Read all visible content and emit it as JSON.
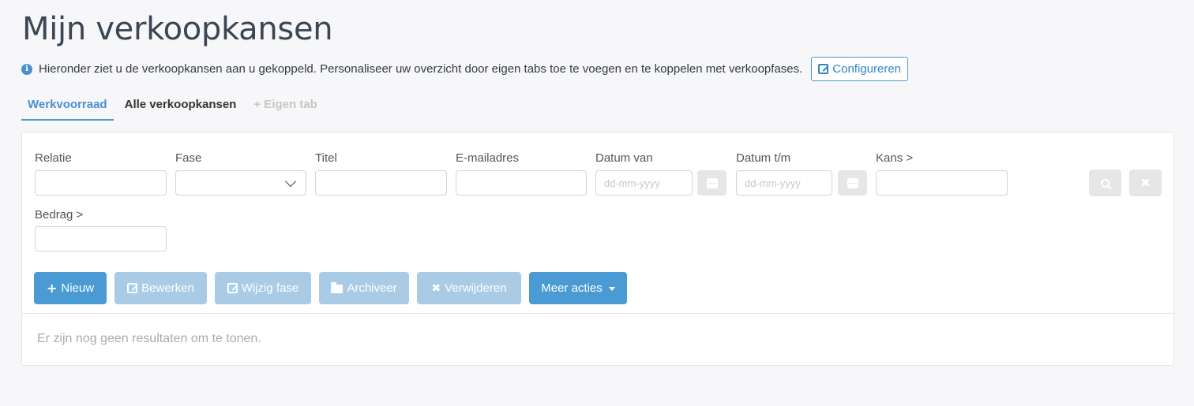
{
  "page": {
    "title": "Mijn verkoopkansen",
    "info_text": "Hieronder ziet u de verkoopkansen aan u gekoppeld. Personaliseer uw overzicht door eigen tabs toe te voegen en te koppelen met verkoopfases.",
    "configure_label": "Configureren"
  },
  "tabs": [
    {
      "label": "Werkvoorraad",
      "active": true
    },
    {
      "label": "Alle verkoopkansen",
      "active": false
    },
    {
      "label": "+ Eigen tab",
      "active": false
    }
  ],
  "filters": {
    "relatie": {
      "label": "Relatie",
      "value": ""
    },
    "fase": {
      "label": "Fase",
      "value": ""
    },
    "titel": {
      "label": "Titel",
      "value": ""
    },
    "email": {
      "label": "E-mailadres",
      "value": ""
    },
    "datum_van": {
      "label": "Datum van",
      "placeholder": "dd-mm-yyyy"
    },
    "datum_tm": {
      "label": "Datum t/m",
      "placeholder": "dd-mm-yyyy"
    },
    "kans": {
      "label": "Kans >",
      "value": ""
    },
    "bedrag": {
      "label": "Bedrag >",
      "value": ""
    }
  },
  "actions": {
    "nieuw": "Nieuw",
    "bewerken": "Bewerken",
    "wijzig_fase": "Wijzig fase",
    "archiveer": "Archiveer",
    "verwijderen": "Verwijderen",
    "meer_acties": "Meer acties"
  },
  "results": {
    "empty_message": "Er zijn nog geen resultaten om te tonen."
  },
  "colors": {
    "primary": "#4a9bd4",
    "primary_disabled": "#a9cbe6",
    "title": "#3a4654",
    "background": "#f7f7f9"
  }
}
